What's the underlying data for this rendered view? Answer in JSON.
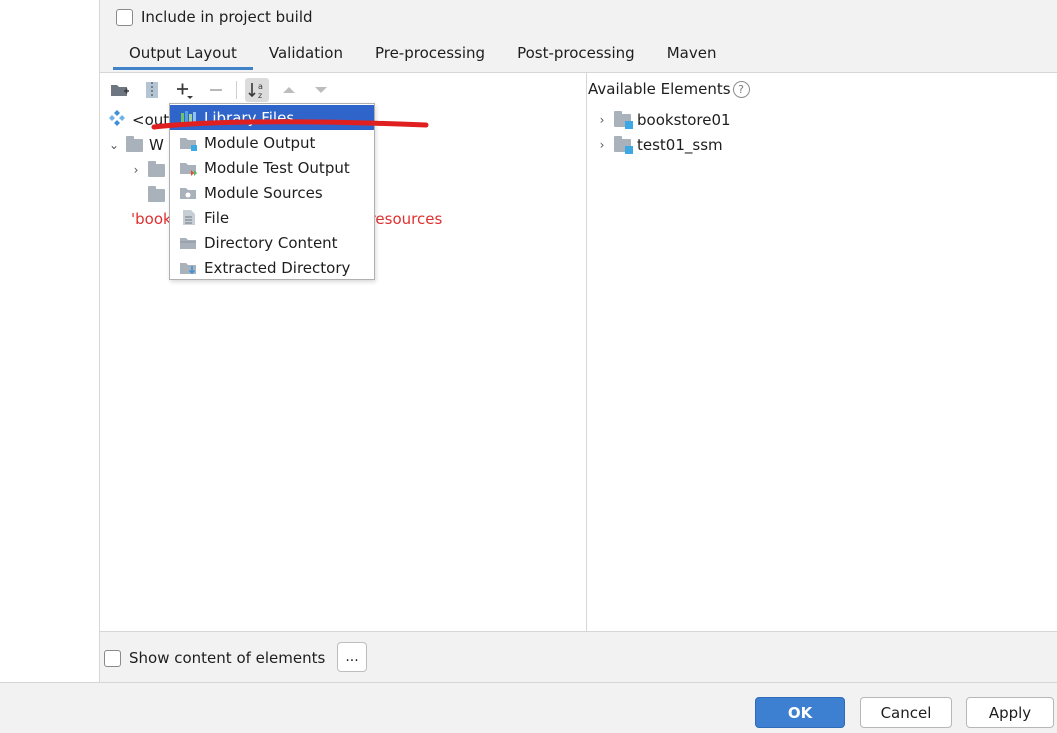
{
  "include_build": {
    "label": "Include in project build",
    "checked": false
  },
  "tabs": [
    {
      "label": "Output Layout",
      "active": true
    },
    {
      "label": "Validation",
      "active": false
    },
    {
      "label": "Pre-processing",
      "active": false
    },
    {
      "label": "Post-processing",
      "active": false
    },
    {
      "label": "Maven",
      "active": false
    }
  ],
  "toolbar": {
    "icons": [
      "new-directory-icon",
      "archive-icon",
      "add-icon",
      "remove-icon",
      "sort-icon",
      "move-up-icon",
      "move-down-icon"
    ]
  },
  "layout_tree": {
    "root_label": "<out",
    "child_label": "W",
    "error_prefix": "'book",
    "error_suffix": "et resources"
  },
  "add_menu": {
    "items": [
      {
        "label": "Library Files",
        "icon": "library-icon",
        "highlighted": true
      },
      {
        "label": "Module Output",
        "icon": "module-output-icon",
        "highlighted": false
      },
      {
        "label": "Module Test Output",
        "icon": "module-test-output-icon",
        "highlighted": false
      },
      {
        "label": "Module Sources",
        "icon": "module-sources-icon",
        "highlighted": false
      },
      {
        "label": "File",
        "icon": "file-icon",
        "highlighted": false
      },
      {
        "label": "Directory Content",
        "icon": "directory-content-icon",
        "highlighted": false
      },
      {
        "label": "Extracted Directory",
        "icon": "extracted-directory-icon",
        "highlighted": false
      }
    ]
  },
  "available": {
    "title": "Available Elements",
    "help": "?",
    "items": [
      {
        "label": "bookstore01",
        "icon": "module-folder-icon"
      },
      {
        "label": "test01_ssm",
        "icon": "module-folder-icon"
      }
    ]
  },
  "show_content": {
    "label": "Show content of elements",
    "checked": false,
    "button": "..."
  },
  "footer": {
    "ok": "OK",
    "cancel": "Cancel",
    "apply": "Apply"
  },
  "colors": {
    "accent": "#3d7fd0",
    "menu_highlight": "#2f65ca",
    "error": "#e03030",
    "annotation": "#e02020"
  }
}
